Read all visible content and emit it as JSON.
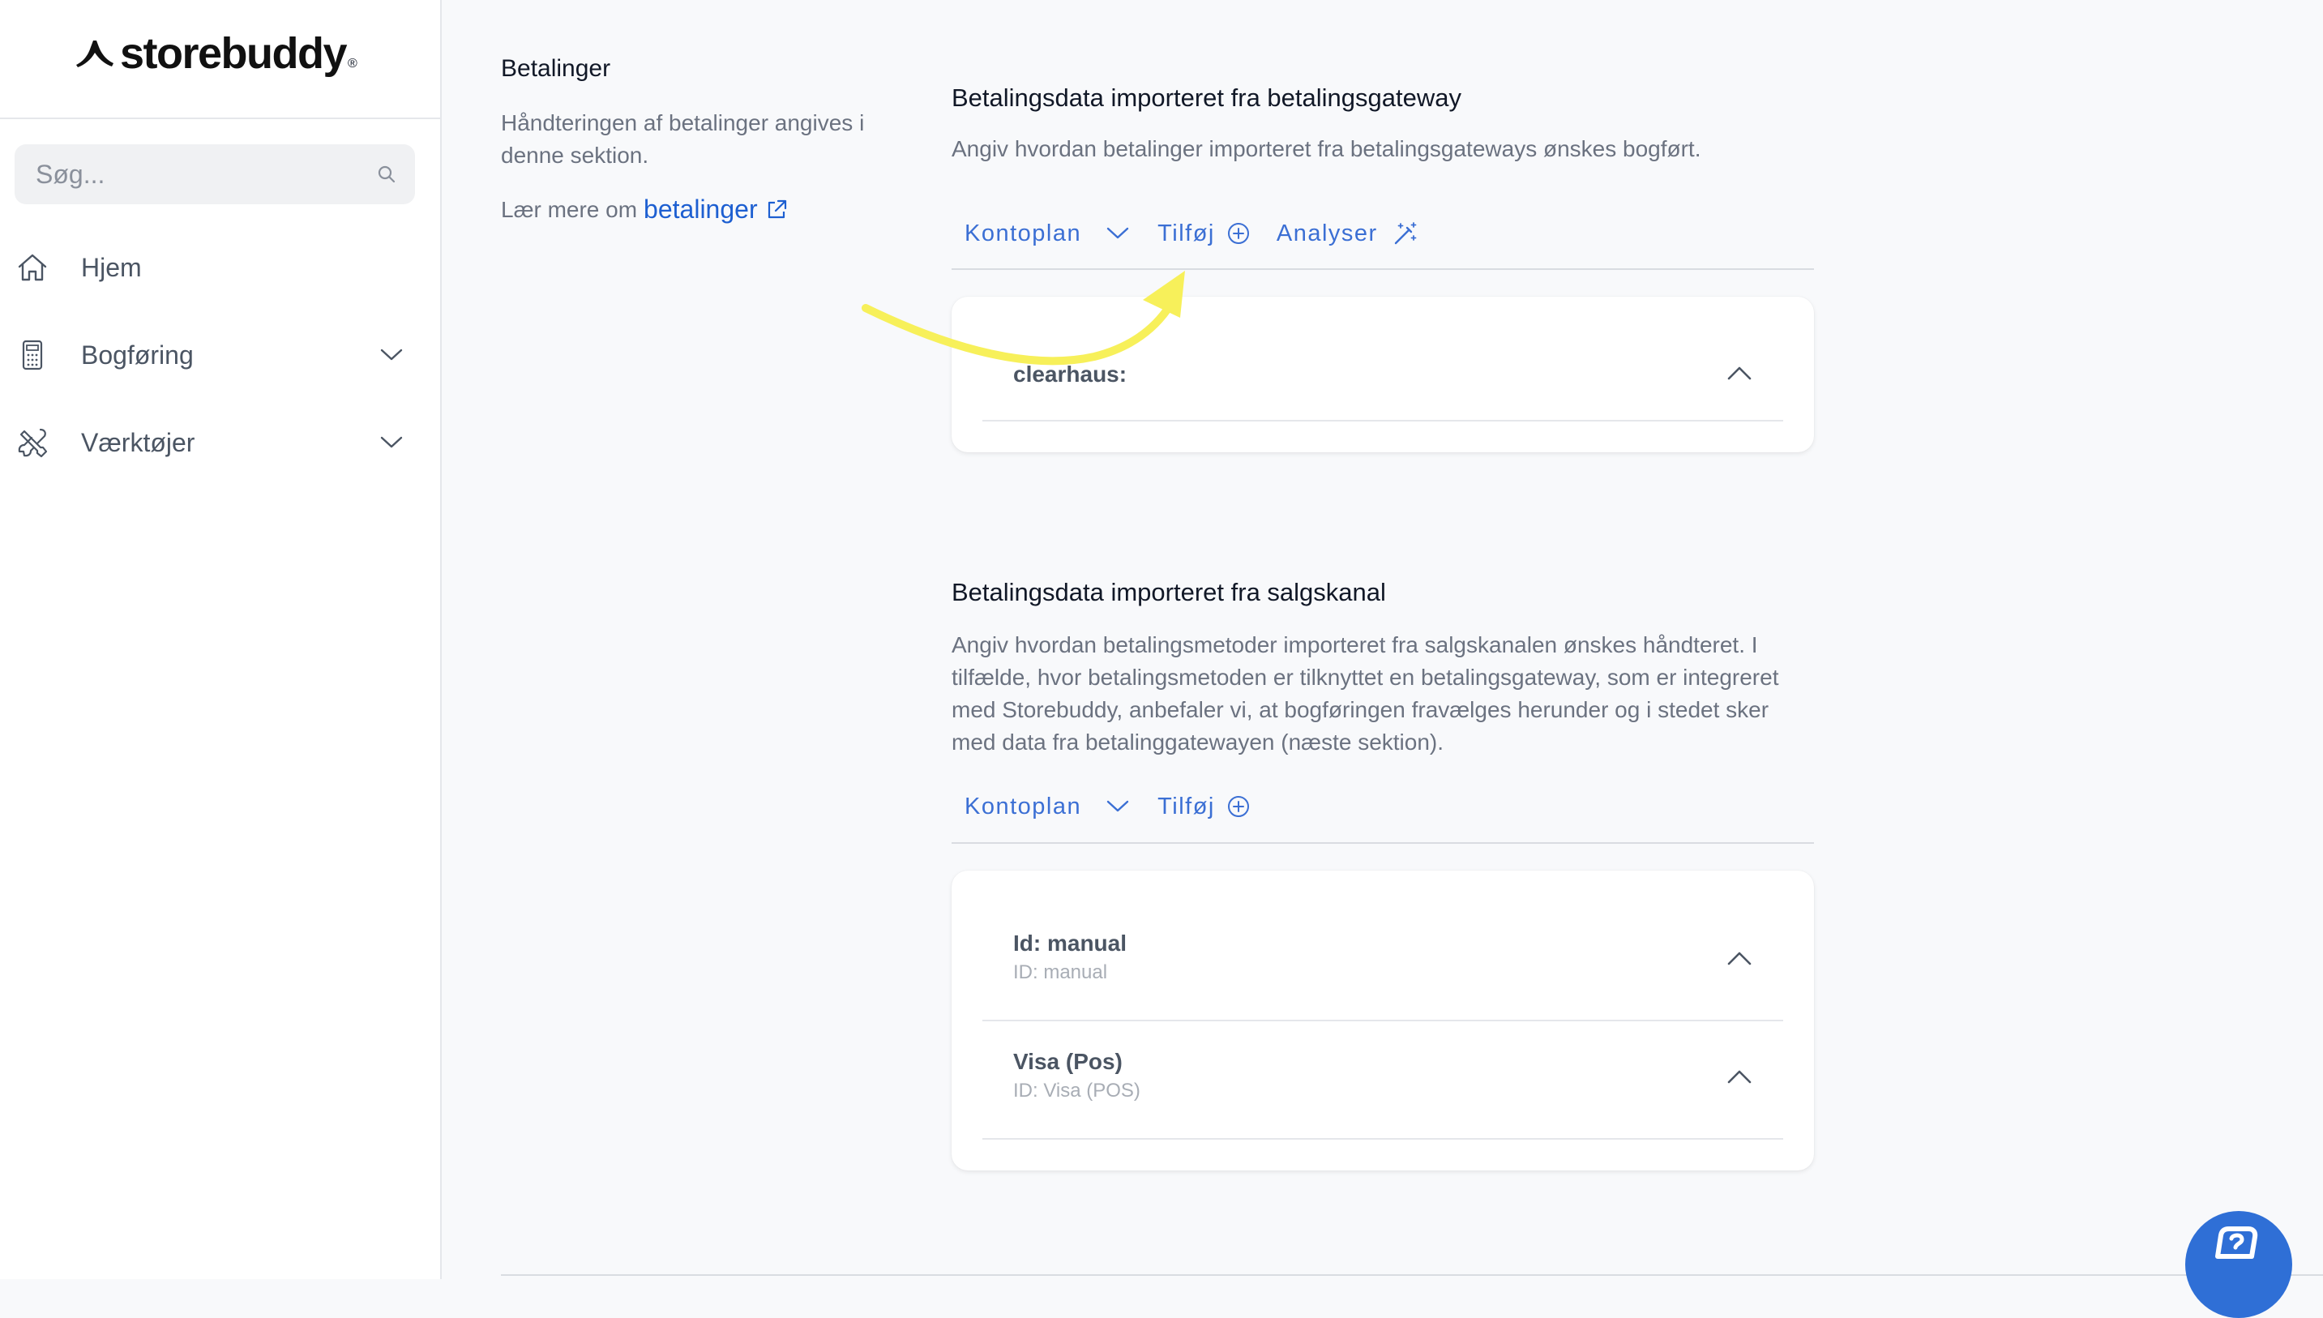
{
  "brand": {
    "name": "storebuddy",
    "trademark": "®"
  },
  "search": {
    "placeholder": "Søg..."
  },
  "nav": [
    {
      "label": "Hjem",
      "icon": "home-icon"
    },
    {
      "label": "Bogføring",
      "icon": "calculator-icon"
    },
    {
      "label": "Værktøjer",
      "icon": "tools-icon"
    }
  ],
  "section": {
    "title": "Betalinger",
    "description": "Håndteringen af betalinger angives i denne sektion.",
    "learn_prefix": "Lær mere om",
    "learn_link": "betalinger"
  },
  "gateway": {
    "title": "Betalingsdata importeret fra betalingsgateway",
    "description": "Angiv hvordan betalinger importeret fra betalingsgateways ønskes bogført.",
    "toolbar": {
      "kontoplan": "Kontoplan",
      "add": "Tilføj",
      "analyze": "Analyser"
    },
    "items": [
      {
        "title": "clearhaus:"
      }
    ]
  },
  "saleschannel": {
    "title": "Betalingsdata importeret fra salgskanal",
    "description": "Angiv hvordan betalingsmetoder importeret fra salgskanalen ønskes håndteret. I tilfælde, hvor betalingsmetoden er tilknyttet en betalingsgateway, som er integreret med Storebuddy, anbefaler vi, at bogføringen fravælges herunder og i stedet sker med data fra betalinggatewayen (næste sektion).",
    "toolbar": {
      "kontoplan": "Kontoplan",
      "add": "Tilføj"
    },
    "items": [
      {
        "title": "Id: manual",
        "subtitle": "ID: manual"
      },
      {
        "title": "Visa (Pos)",
        "subtitle": "ID: Visa (POS)"
      }
    ]
  },
  "colors": {
    "link": "#1d5fd1",
    "toolbar": "#3b6fd4",
    "annotation_arrow": "#f7f05a",
    "help_button": "#2f6fd6"
  }
}
